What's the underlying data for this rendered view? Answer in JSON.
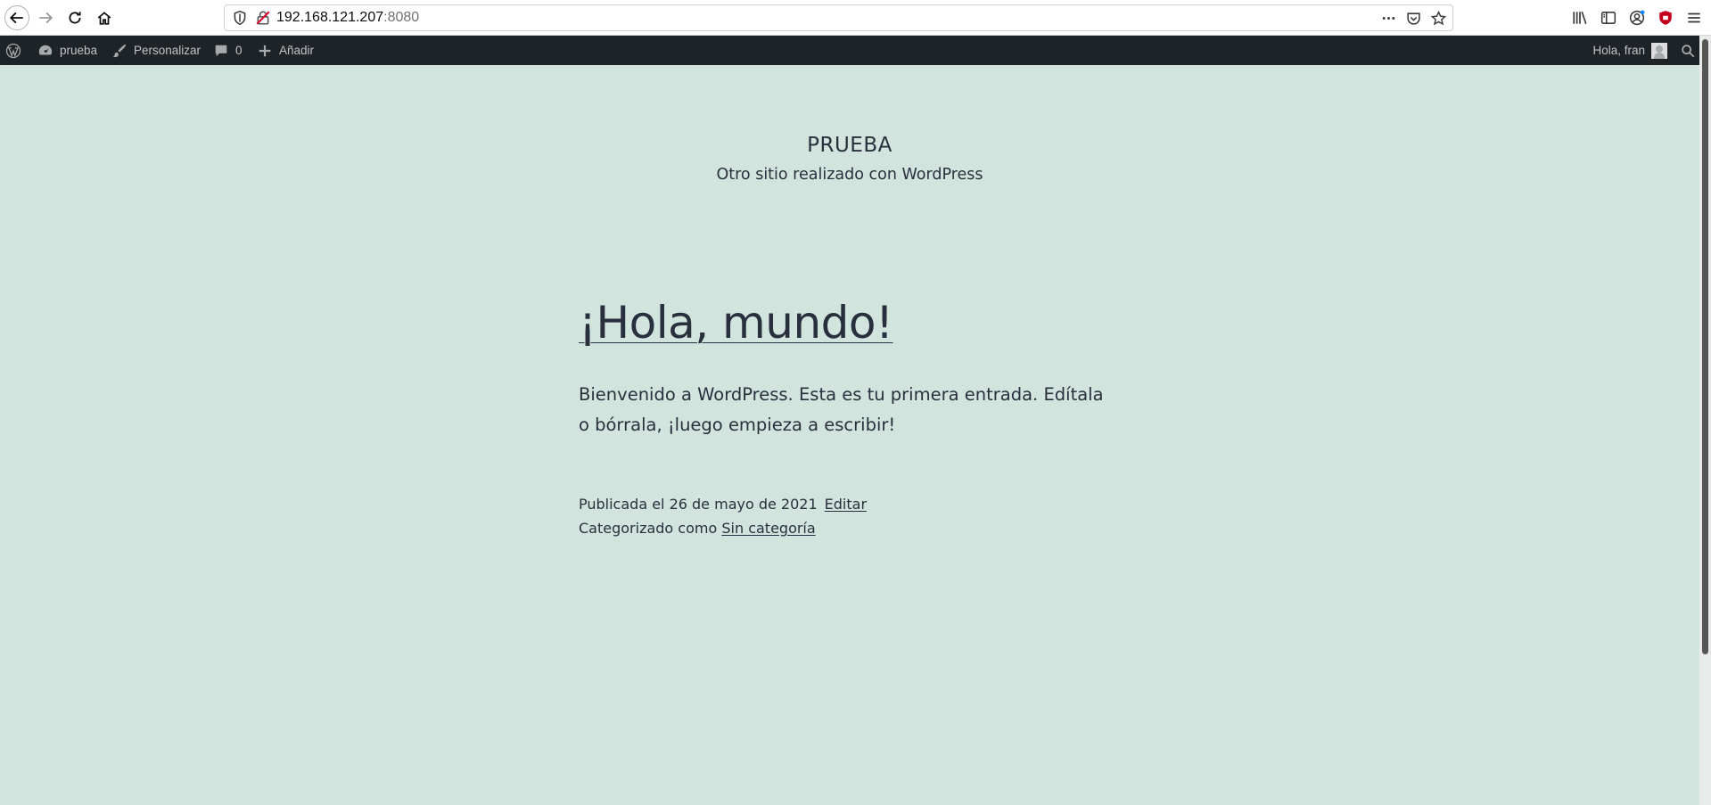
{
  "browser": {
    "url_host": "192.168.121.207",
    "url_port": ":8080"
  },
  "adminbar": {
    "site_name": "prueba",
    "customize": "Personalizar",
    "comments_count": "0",
    "new": "Añadir",
    "howdy": "Hola, fran"
  },
  "site": {
    "title": "PRUEBA",
    "description": "Otro sitio realizado con WordPress"
  },
  "post": {
    "title": "¡Hola, mundo!",
    "body": "Bienvenido a WordPress. Esta es tu primera entrada. Edítala o bórrala, ¡luego empieza a escribir!",
    "published": "Publicada el 26 de mayo de 2021",
    "edit": "Editar",
    "category_prefix": "Categorizado como",
    "category": "Sin categoría"
  }
}
